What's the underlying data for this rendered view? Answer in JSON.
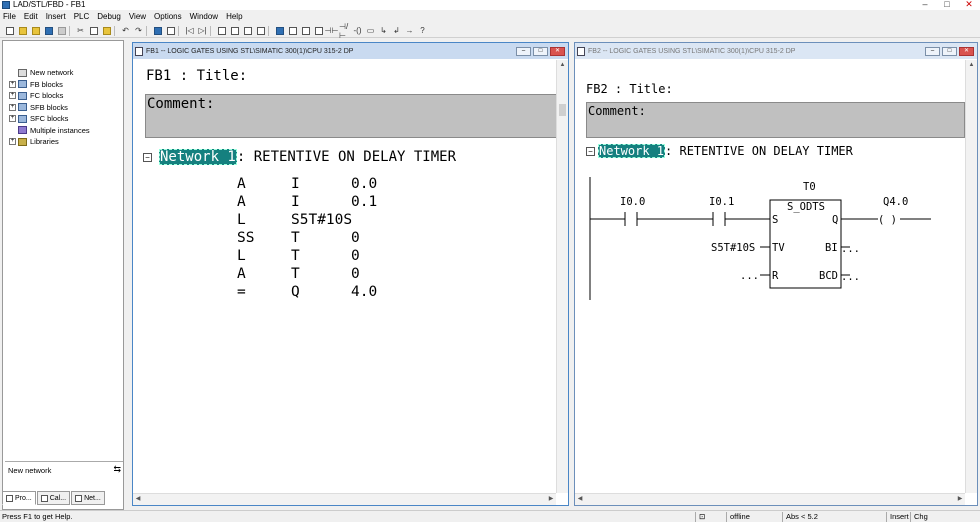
{
  "app": {
    "title": "LAD/STL/FBD - FB1"
  },
  "menu": [
    "File",
    "Edit",
    "Insert",
    "PLC",
    "Debug",
    "View",
    "Options",
    "Window",
    "Help"
  ],
  "tree": {
    "items": [
      {
        "label": "New network",
        "expandable": false,
        "icon": "network-icon"
      },
      {
        "label": "FB blocks",
        "expandable": true,
        "icon": "block-icon"
      },
      {
        "label": "FC blocks",
        "expandable": true,
        "icon": "block-icon"
      },
      {
        "label": "SFB blocks",
        "expandable": true,
        "icon": "block-icon"
      },
      {
        "label": "SFC blocks",
        "expandable": true,
        "icon": "block-icon"
      },
      {
        "label": "Multiple instances",
        "expandable": false,
        "icon": "multi-instance-icon"
      },
      {
        "label": "Libraries",
        "expandable": true,
        "icon": "library-icon"
      }
    ],
    "info_label": "New network",
    "tabs": [
      "Pro...",
      "Cal...",
      "Net..."
    ]
  },
  "window1": {
    "title": "FB1 -- LOGIC GATES USING STL\\SIMATIC 300(1)\\CPU 315-2 DP",
    "block_title": "FB1 : Title:",
    "comment": "Comment:",
    "network_label": "Network 1",
    "network_title": ": RETENTIVE ON DELAY TIMER",
    "stl": [
      {
        "op": "A",
        "addr": "I",
        "val": "0.0"
      },
      {
        "op": "A",
        "addr": "I",
        "val": "0.1"
      },
      {
        "op": "L",
        "addr": "S5T#10S",
        "val": ""
      },
      {
        "op": "SS",
        "addr": "T",
        "val": "0"
      },
      {
        "op": "L",
        "addr": "T",
        "val": "0"
      },
      {
        "op": "A",
        "addr": "T",
        "val": "0"
      },
      {
        "op": "=",
        "addr": "Q",
        "val": "4.0"
      }
    ]
  },
  "window2": {
    "title": "FB2 -- LOGIC GATES USING STL\\SIMATIC 300(1)\\CPU 315-2 DP",
    "block_title": "FB2 : Title:",
    "comment": "Comment:",
    "network_label": "Network 1",
    "network_title": ": RETENTIVE ON DELAY TIMER",
    "ladder": {
      "contact1": "I0.0",
      "contact2": "I0.1",
      "timer_name": "T0",
      "timer_type": "S_ODTS",
      "pin_s": "S",
      "pin_q": "Q",
      "pin_tv": "TV",
      "pin_bi": "BI",
      "pin_r": "R",
      "pin_bcd": "BCD",
      "tv_value": "S5T#10S",
      "bi_value": "...",
      "r_value": "...",
      "bcd_value": "...",
      "coil": "Q4.0",
      "coil_symbol": "( )"
    }
  },
  "status": {
    "help": "Press F1 to get Help.",
    "mode": "offline",
    "abs": "Abs < 5.2",
    "insert": "Insert",
    "chg": "Chg"
  }
}
